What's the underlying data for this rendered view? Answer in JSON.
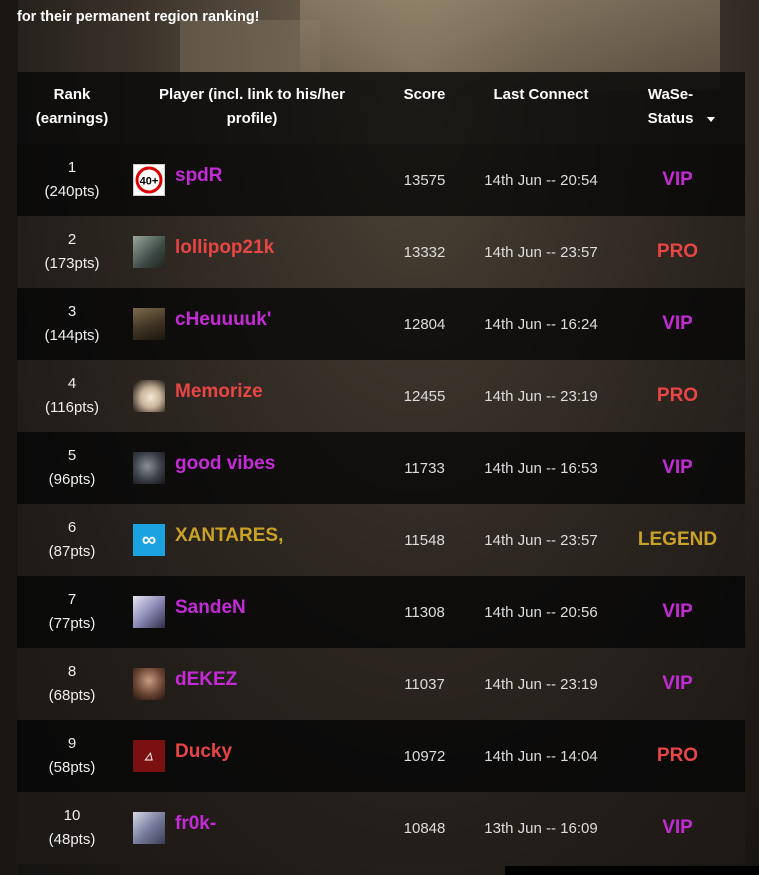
{
  "intro": {
    "line_partial": "",
    "line2": "for their permanent region ranking!"
  },
  "table": {
    "headers": {
      "rank": "Rank (earnings)",
      "player": "Player (incl. link to his/her profile)",
      "score": "Score",
      "last_connect": "Last Connect",
      "status": "WaSe-Status"
    },
    "rows": [
      {
        "rank": "1",
        "pts": "(240pts)",
        "name": "spdR",
        "avatar": "age-40-badge-icon",
        "score": "13575",
        "conn": "14th Jun -- 20:54",
        "status": "VIP"
      },
      {
        "rank": "2",
        "pts": "(173pts)",
        "name": "lollipop21k",
        "avatar": "player-photo-icon",
        "score": "13332",
        "conn": "14th Jun -- 23:57",
        "status": "PRO"
      },
      {
        "rank": "3",
        "pts": "(144pts)",
        "name": "cHeuuuuk'",
        "avatar": "soldier-photo-icon",
        "score": "12804",
        "conn": "14th Jun -- 16:24",
        "status": "VIP"
      },
      {
        "rank": "4",
        "pts": "(116pts)",
        "name": "Memorize",
        "avatar": "anime-face-icon",
        "score": "12455",
        "conn": "14th Jun -- 23:19",
        "status": "PRO"
      },
      {
        "rank": "5",
        "pts": "(96pts)",
        "name": "good vibes",
        "avatar": "dark-portrait-icon",
        "score": "11733",
        "conn": "14th Jun -- 16:53",
        "status": "VIP"
      },
      {
        "rank": "6",
        "pts": "(87pts)",
        "name": "XANTARES,",
        "avatar": "infinity-logo-icon",
        "score": "11548",
        "conn": "14th Jun -- 23:57",
        "status": "LEGEND"
      },
      {
        "rank": "7",
        "pts": "(77pts)",
        "name": "SandeN",
        "avatar": "anime-character-icon",
        "score": "11308",
        "conn": "14th Jun -- 20:56",
        "status": "VIP"
      },
      {
        "rank": "8",
        "pts": "(68pts)",
        "name": "dEKEZ",
        "avatar": "woman-portrait-icon",
        "score": "11037",
        "conn": "14th Jun -- 23:19",
        "status": "VIP"
      },
      {
        "rank": "9",
        "pts": "(58pts)",
        "name": "Ducky",
        "avatar": "red-logo-icon",
        "score": "10972",
        "conn": "14th Jun -- 14:04",
        "status": "PRO"
      },
      {
        "rank": "10",
        "pts": "(48pts)",
        "name": "fr0k-",
        "avatar": "anime-girl-icon",
        "score": "10848",
        "conn": "13th Jun -- 16:09",
        "status": "VIP"
      }
    ]
  },
  "colors": {
    "VIP": "#c42bd6",
    "PRO": "#e84545",
    "LEGEND": "#c9a227"
  }
}
